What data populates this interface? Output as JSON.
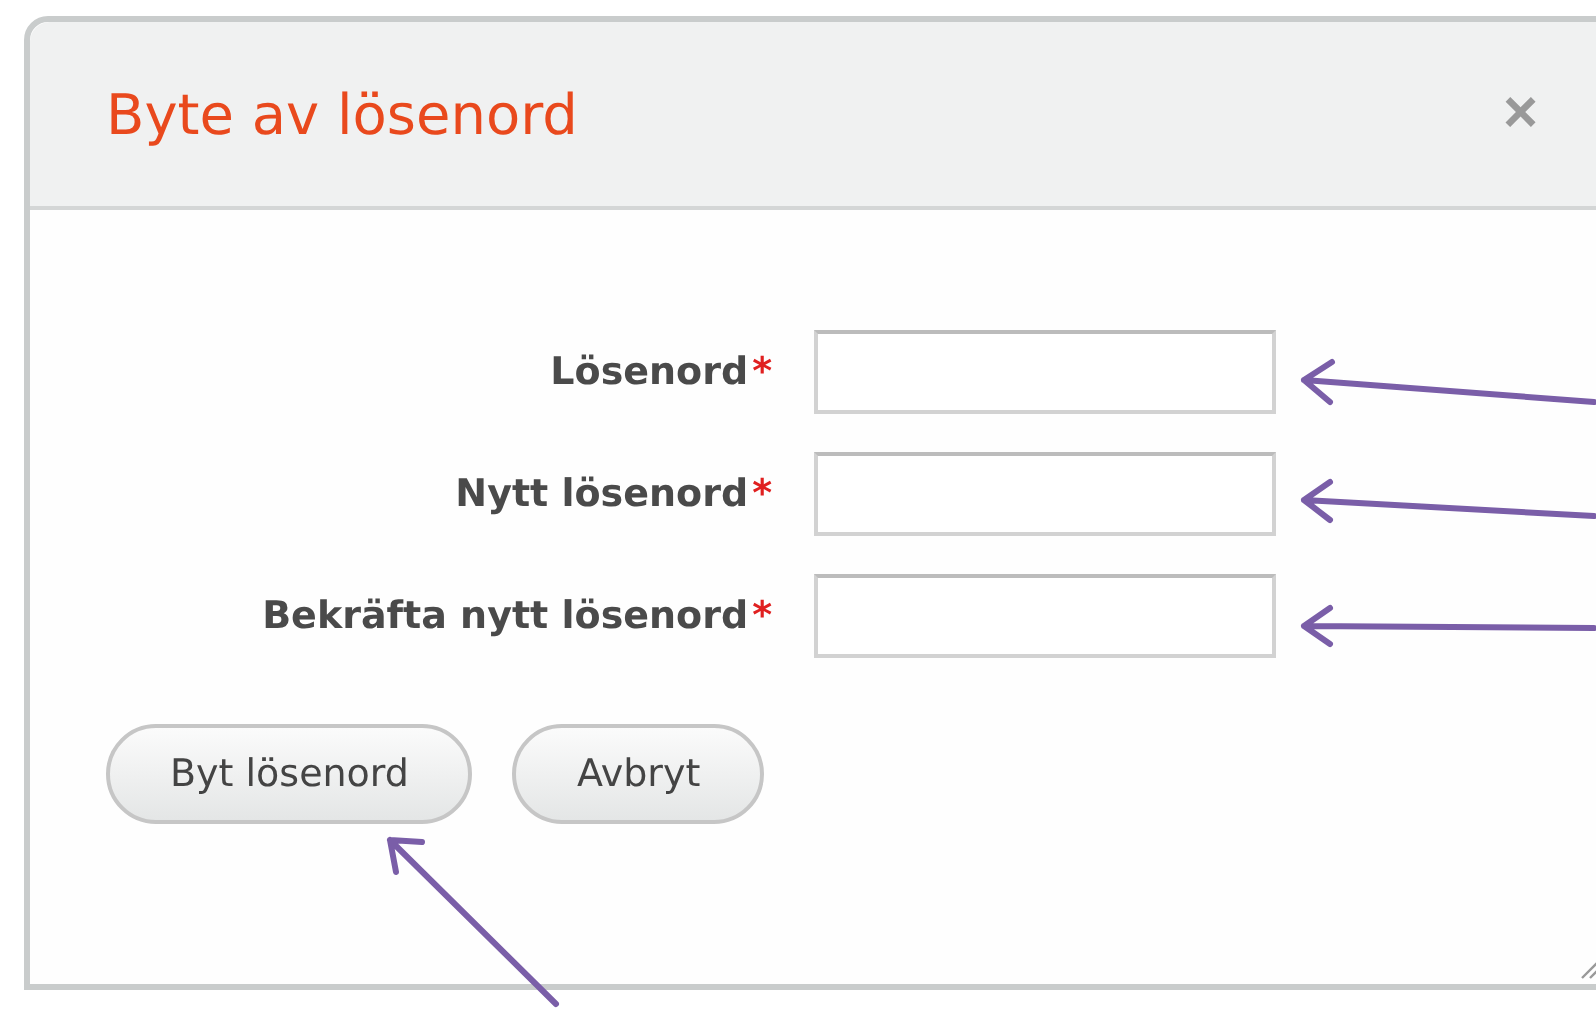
{
  "dialog": {
    "title": "Byte av lösenord",
    "close_label": "×"
  },
  "fields": [
    {
      "label": "Lösenord",
      "required_mark": "*"
    },
    {
      "label": "Nytt lösenord",
      "required_mark": "*"
    },
    {
      "label": "Bekräfta nytt lösenord",
      "required_mark": "*"
    }
  ],
  "buttons": [
    {
      "label": "Byt lösenord"
    },
    {
      "label": "Avbryt"
    }
  ]
}
